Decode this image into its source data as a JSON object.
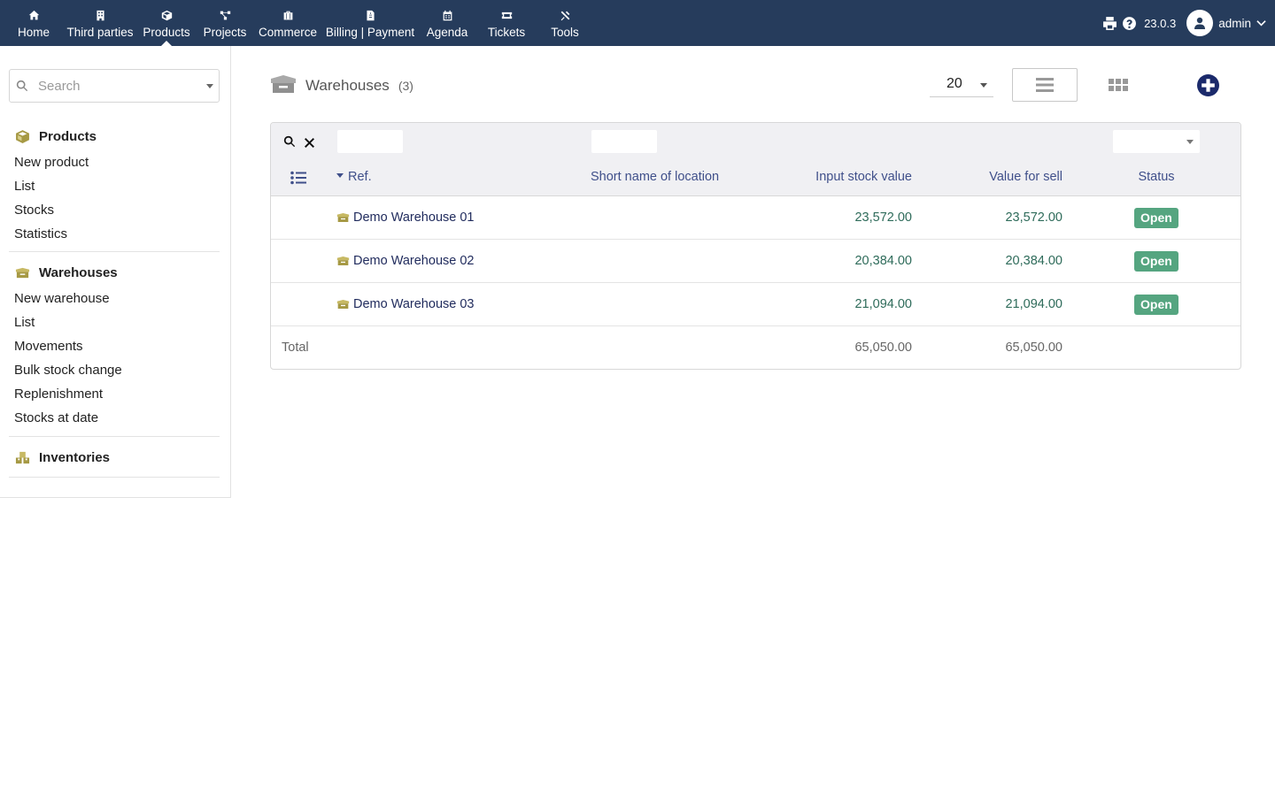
{
  "topbar": {
    "menu": [
      {
        "label": "Home",
        "icon": "home-icon"
      },
      {
        "label": "Third parties",
        "icon": "building-icon"
      },
      {
        "label": "Products",
        "icon": "cube-icon"
      },
      {
        "label": "Projects",
        "icon": "project-icon"
      },
      {
        "label": "Commerce",
        "icon": "briefcase-icon"
      },
      {
        "label": "Billing | Payment",
        "icon": "invoice-icon"
      },
      {
        "label": "Agenda",
        "icon": "calendar-icon"
      },
      {
        "label": "Tickets",
        "icon": "ticket-icon"
      },
      {
        "label": "Tools",
        "icon": "tools-icon"
      }
    ],
    "active_menu": "Products",
    "version": "23.0.3",
    "username": "admin"
  },
  "sidebar": {
    "search_placeholder": "Search",
    "sections": [
      {
        "title": "Products",
        "links": [
          "New product",
          "List",
          "Stocks",
          "Statistics"
        ]
      },
      {
        "title": "Warehouses",
        "links": [
          "New warehouse",
          "List",
          "Movements",
          "Bulk stock change",
          "Replenishment",
          "Stocks at date"
        ]
      },
      {
        "title": "Inventories",
        "links": []
      }
    ]
  },
  "page": {
    "title": "Warehouses",
    "count": "(3)",
    "limit": "20"
  },
  "table": {
    "columns": {
      "ref": "Ref.",
      "short_name": "Short name of location",
      "input_stock_value": "Input stock value",
      "value_for_sell": "Value for sell",
      "status": "Status"
    },
    "rows": [
      {
        "ref": "Demo Warehouse 01",
        "short_name": "",
        "input_stock_value": "23,572.00",
        "value_for_sell": "23,572.00",
        "status": "Open"
      },
      {
        "ref": "Demo Warehouse 02",
        "short_name": "",
        "input_stock_value": "20,384.00",
        "value_for_sell": "20,384.00",
        "status": "Open"
      },
      {
        "ref": "Demo Warehouse 03",
        "short_name": "",
        "input_stock_value": "21,094.00",
        "value_for_sell": "21,094.00",
        "status": "Open"
      }
    ],
    "total": {
      "label": "Total",
      "input_stock_value": "65,050.00",
      "value_for_sell": "65,050.00"
    }
  },
  "colors": {
    "topbar_bg": "#263c5c",
    "link": "#3f4f8a",
    "number": "#2e6b5a",
    "status_open": "#55a580",
    "warehouse_icon": "#a69944"
  }
}
